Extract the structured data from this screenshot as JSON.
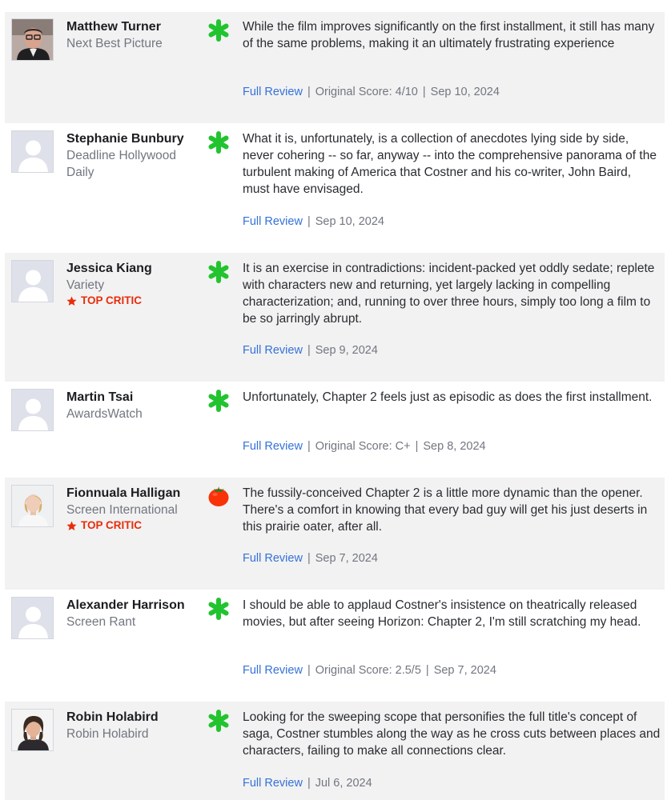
{
  "colors": {
    "row_shade": "#f2f2f2",
    "link": "#3471d9",
    "top_critic": "#e82d0c",
    "splat": "#21c42f",
    "tomato": "#f93208"
  },
  "reviews": [
    {
      "critic_name": "Matthew Turner",
      "publication": "Next Best Picture",
      "top_critic": "",
      "score_icon": "rotten-splat-icon",
      "quote": "While the film improves significantly on the first installment, it still has many of the same problems, making it an ultimately frustrating experience",
      "link_label": "Full Review",
      "original_score": "Original Score: 4/10",
      "date": "Sep 10, 2024"
    },
    {
      "critic_name": "Stephanie Bunbury",
      "publication": "Deadline Hollywood Daily",
      "top_critic": "",
      "score_icon": "rotten-splat-icon",
      "quote": "What it is, unfortunately, is a collection of anecdotes lying side by side, never cohering -- so far, anyway -- into the comprehensive panorama of the turbulent making of America that Costner and his co-writer, John Baird, must have envisaged.",
      "link_label": "Full Review",
      "original_score": "",
      "date": "Sep 10, 2024"
    },
    {
      "critic_name": "Jessica Kiang",
      "publication": "Variety",
      "top_critic": "TOP CRITIC",
      "score_icon": "rotten-splat-icon",
      "quote": "It is an exercise in contradictions: incident-packed yet oddly sedate; replete with characters new and returning, yet largely lacking in compelling characterization; and, running to over three hours, simply too long a film to be so jarringly abrupt.",
      "link_label": "Full Review",
      "original_score": "",
      "date": "Sep 9, 2024"
    },
    {
      "critic_name": "Martin Tsai",
      "publication": "AwardsWatch",
      "top_critic": "",
      "score_icon": "rotten-splat-icon",
      "quote": "Unfortunately, Chapter 2 feels just as episodic as does the first installment.",
      "link_label": "Full Review",
      "original_score": "Original Score: C+",
      "date": "Sep 8, 2024"
    },
    {
      "critic_name": "Fionnuala Halligan",
      "publication": "Screen International",
      "top_critic": "TOP CRITIC",
      "score_icon": "fresh-tomato-icon",
      "quote": "The fussily-conceived Chapter 2 is a little more dynamic than the opener. There's a comfort in knowing that every bad guy will get his just deserts in this prairie oater, after all.",
      "link_label": "Full Review",
      "original_score": "",
      "date": "Sep 7, 2024"
    },
    {
      "critic_name": "Alexander Harrison",
      "publication": "Screen Rant",
      "top_critic": "",
      "score_icon": "rotten-splat-icon",
      "quote": "I should be able to applaud Costner's insistence on theatrically released movies, but after seeing Horizon: Chapter 2, I'm still scratching my head.",
      "link_label": "Full Review",
      "original_score": "Original Score: 2.5/5",
      "date": "Sep 7, 2024"
    },
    {
      "critic_name": "Robin Holabird",
      "publication": "Robin Holabird",
      "top_critic": "",
      "score_icon": "rotten-splat-icon",
      "quote": "Looking for the sweeping scope that personifies the full title's concept of saga, Costner stumbles along the way as he cross cuts between places and characters, failing to make all connections clear.",
      "link_label": "Full Review",
      "original_score": "",
      "date": "Jul 6, 2024"
    }
  ]
}
